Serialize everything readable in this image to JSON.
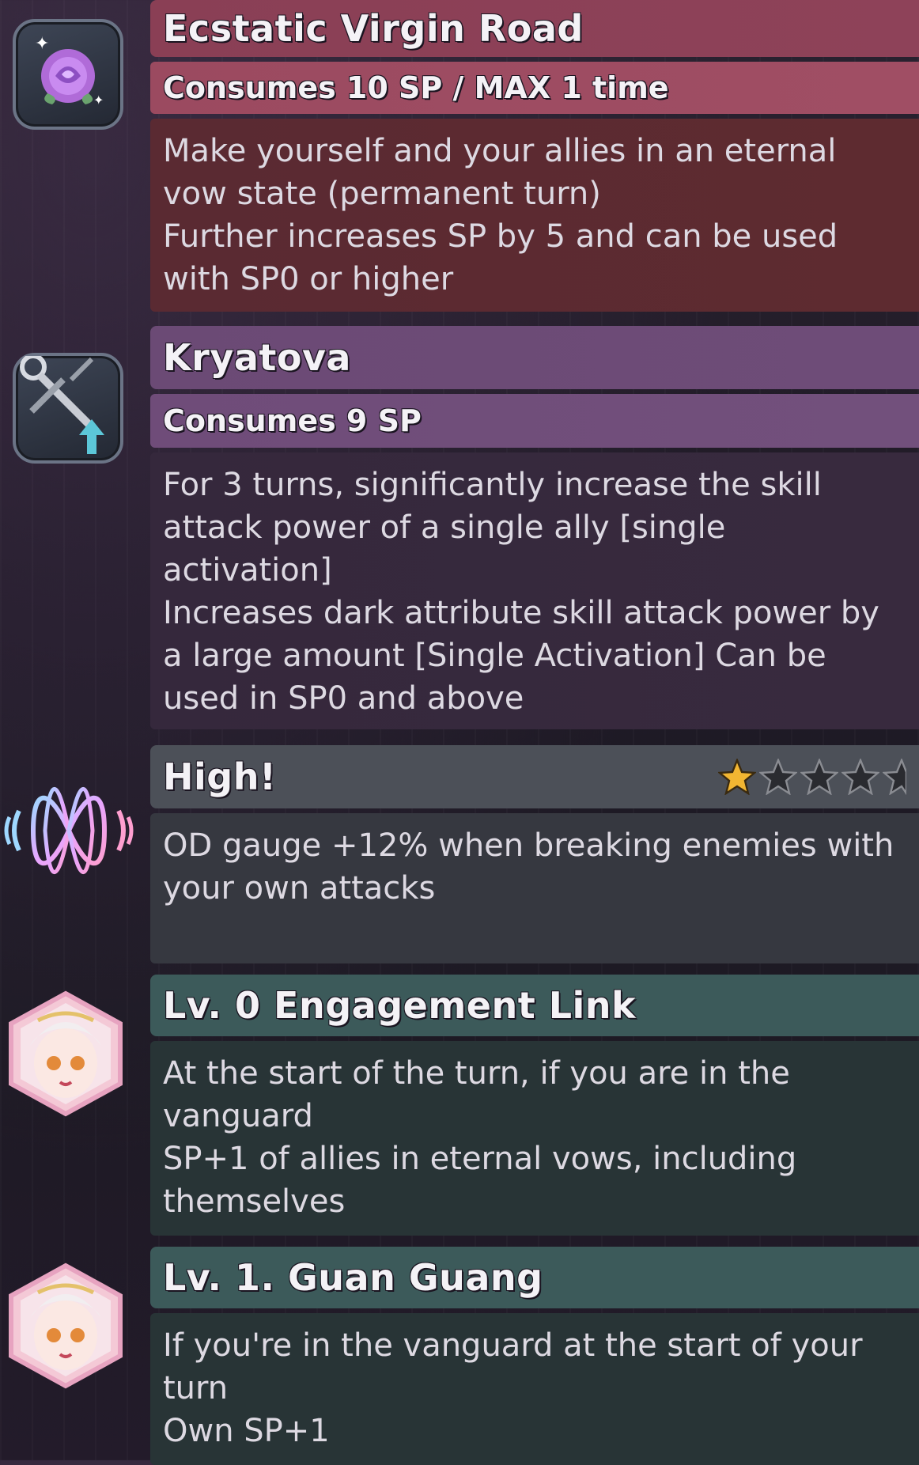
{
  "skills": [
    {
      "icon": "rose-icon",
      "title": "Ecstatic Virgin Road",
      "cost": "Consumes 10 SP / MAX 1 time",
      "description": "Make yourself and your allies in an eternal\nvow state (permanent turn)\nFurther increases SP by 5 and can be used\nwith SP0 or higher"
    },
    {
      "icon": "sword-up-icon",
      "title": "Kryatova",
      "cost": "Consumes 9 SP",
      "description": "For 3 turns, significantly increase the skill\nattack power of a single ally [single\nactivation]\nIncreases dark attribute skill attack power by\na large amount [Single Activation] Can be\nused in SP0 and above"
    }
  ],
  "passive": {
    "icon": "infinity-wave-icon",
    "title": "High!",
    "stars_filled": 1,
    "stars_total": 5,
    "description": "OD gauge +12% when breaking enemies with\nyour own attacks"
  },
  "links": [
    {
      "icon": "character-portrait-icon",
      "title": "Lv. 0 Engagement Link",
      "description": "At the start of the turn, if you are in the\nvanguard\nSP+1 of allies in eternal vows, including\nthemselves"
    },
    {
      "icon": "character-portrait-icon",
      "title": "Lv. 1. Guan Guang",
      "description": "If you're in the vanguard at the start of your\nturn\nOwn SP+1"
    }
  ],
  "colors": {
    "skill_red": "#8a3f55",
    "skill_purple": "#6b4a75",
    "passive_gray": "#4c5058",
    "link_teal": "#3c5a5a",
    "star_gold": "#f2b632"
  }
}
